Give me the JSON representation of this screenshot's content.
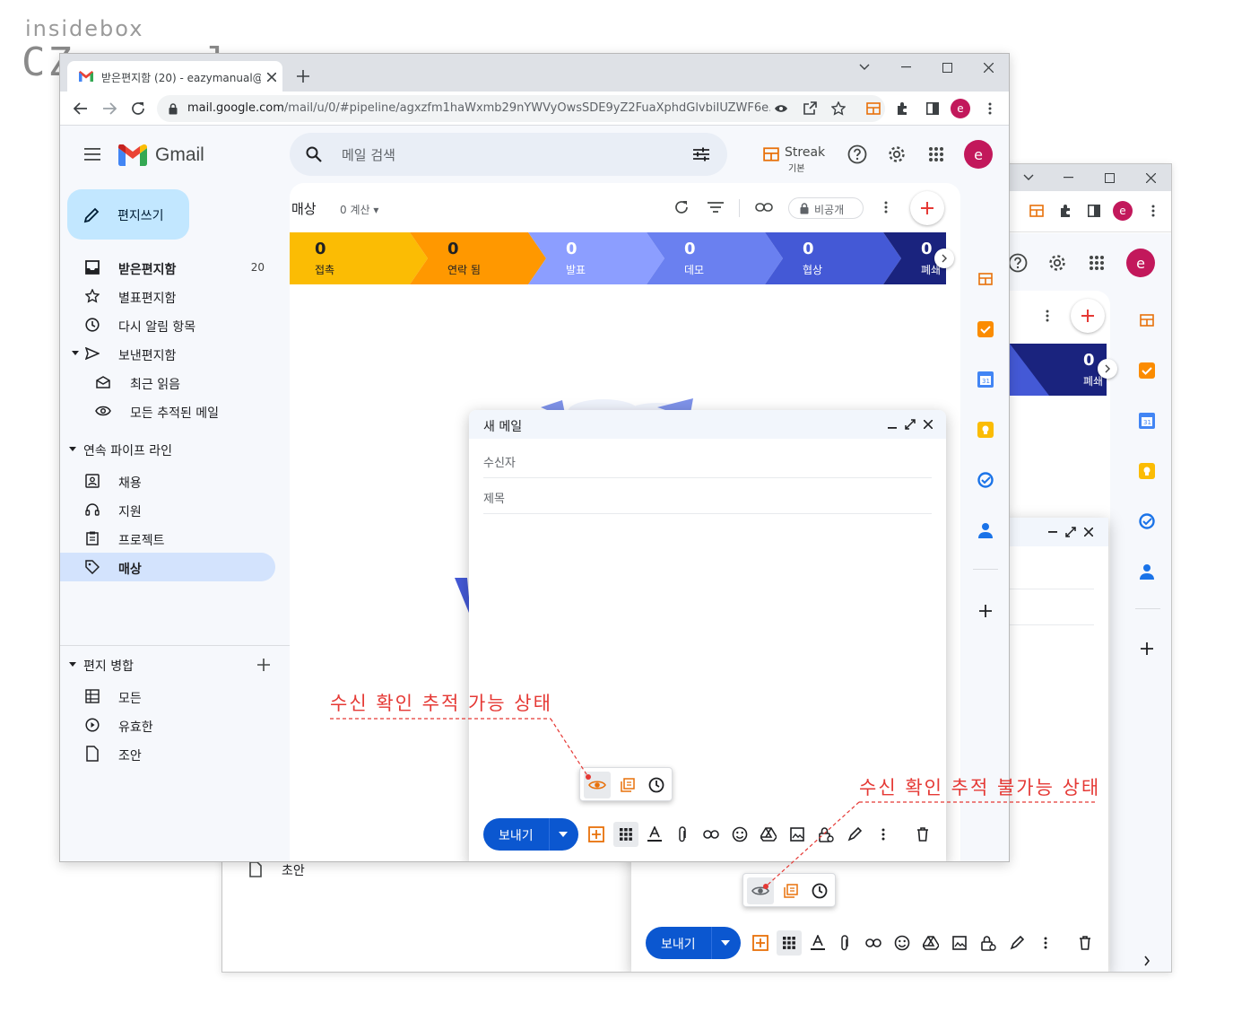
{
  "watermark": {
    "line1": "insidebox",
    "line2": "CZmanual"
  },
  "browser": {
    "tab_title": "받은편지함 (20) - eazymanual@",
    "url_domain": "mail.google.com",
    "url_path": "/mail/u/0/#pipeline/agxzfm1haWxmb29nYWVyOwsSDE9yZ2FuaXphdGlvbiIUZWF6e...",
    "profile_initial": "e"
  },
  "gmail": {
    "product_name": "Gmail",
    "search_placeholder": "메일 검색",
    "streak_label": "Streak",
    "streak_sub": "기본",
    "compose_label": "편지쓰기",
    "nav": [
      {
        "label": "받은편지함",
        "count": "20"
      },
      {
        "label": "별표편지함"
      },
      {
        "label": "다시 알림 항목"
      },
      {
        "label": "보낸편지함"
      },
      {
        "label": "최근 읽음"
      },
      {
        "label": "모든 추적된 메일"
      }
    ],
    "pipelines_header": "연속 파이프 라인",
    "pipelines": [
      {
        "label": "채용"
      },
      {
        "label": "지원"
      },
      {
        "label": "프로젝트"
      },
      {
        "label": "매상"
      }
    ],
    "mailmerge_header": "편지 병합",
    "mailmerge": [
      {
        "label": "모든"
      },
      {
        "label": "유효한"
      },
      {
        "label": "조안"
      }
    ]
  },
  "pipeline_view": {
    "title": "매상",
    "count_label": "0 계산",
    "privacy_label": "비공개",
    "stages": [
      {
        "count": "0",
        "name": "접촉",
        "color": "#fbbc04"
      },
      {
        "count": "0",
        "name": "연락 됨",
        "color": "#ff9800"
      },
      {
        "count": "0",
        "name": "발표",
        "color": "#8c9eff"
      },
      {
        "count": "0",
        "name": "데모",
        "color": "#6a80f0"
      },
      {
        "count": "0",
        "name": "협상",
        "color": "#4459d6"
      },
      {
        "count": "0",
        "name": "폐쇄",
        "color": "#1a237e"
      }
    ]
  },
  "compose": {
    "title": "새 메일",
    "to_placeholder": "수신자",
    "subject_placeholder": "제목",
    "send_label": "보내기"
  },
  "back_window": {
    "stage_count": "0",
    "stage_name": "폐쇄",
    "draft_label": "초안",
    "send_label": "보내기",
    "profile_initial": "e"
  },
  "annotations": {
    "tracking_on": "수신 확인 추적 가능 상태",
    "tracking_off": "수신 확인 추적 불가능 상태",
    "color": "#e53935"
  }
}
